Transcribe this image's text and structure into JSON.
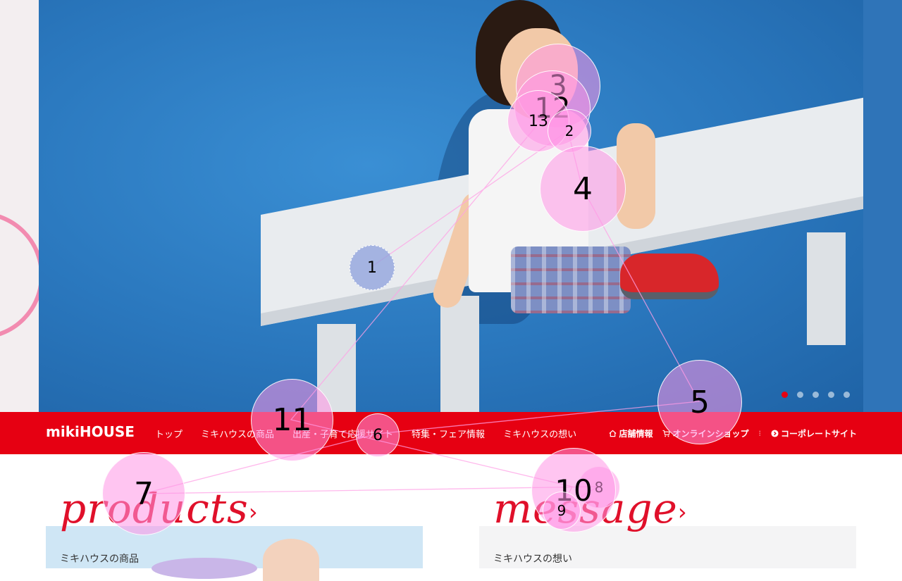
{
  "brand": {
    "logo_text": "mikiHOUSE",
    "accent": "#e60012"
  },
  "hero": {
    "slide_count": 5,
    "active_slide": 1
  },
  "nav": {
    "items": [
      {
        "label": "トップ"
      },
      {
        "label": "ミキハウスの商品"
      },
      {
        "label": "出産・子育て応援サイト"
      },
      {
        "label": "特集・フェア情報"
      },
      {
        "label": "ミキハウスの想い"
      }
    ],
    "utility": [
      {
        "icon": "home-icon",
        "label": "店舗情報"
      },
      {
        "icon": "cart-icon",
        "label": "オンラインショップ"
      },
      {
        "icon": "arrow-circle-icon",
        "label": "コーポレートサイト"
      }
    ],
    "separator": "⁝"
  },
  "sections": {
    "products": {
      "heading": "products",
      "subtitle": "ミキハウスの商品",
      "chevron": "›"
    },
    "message": {
      "heading": "message",
      "subtitle": "ミキハウスの想い",
      "chevron": "›"
    }
  },
  "gaze_overlay": {
    "fixations": [
      "1",
      "2",
      "3",
      "4",
      "5",
      "6",
      "7",
      "8",
      "9",
      "10",
      "11",
      "12",
      "13"
    ]
  }
}
